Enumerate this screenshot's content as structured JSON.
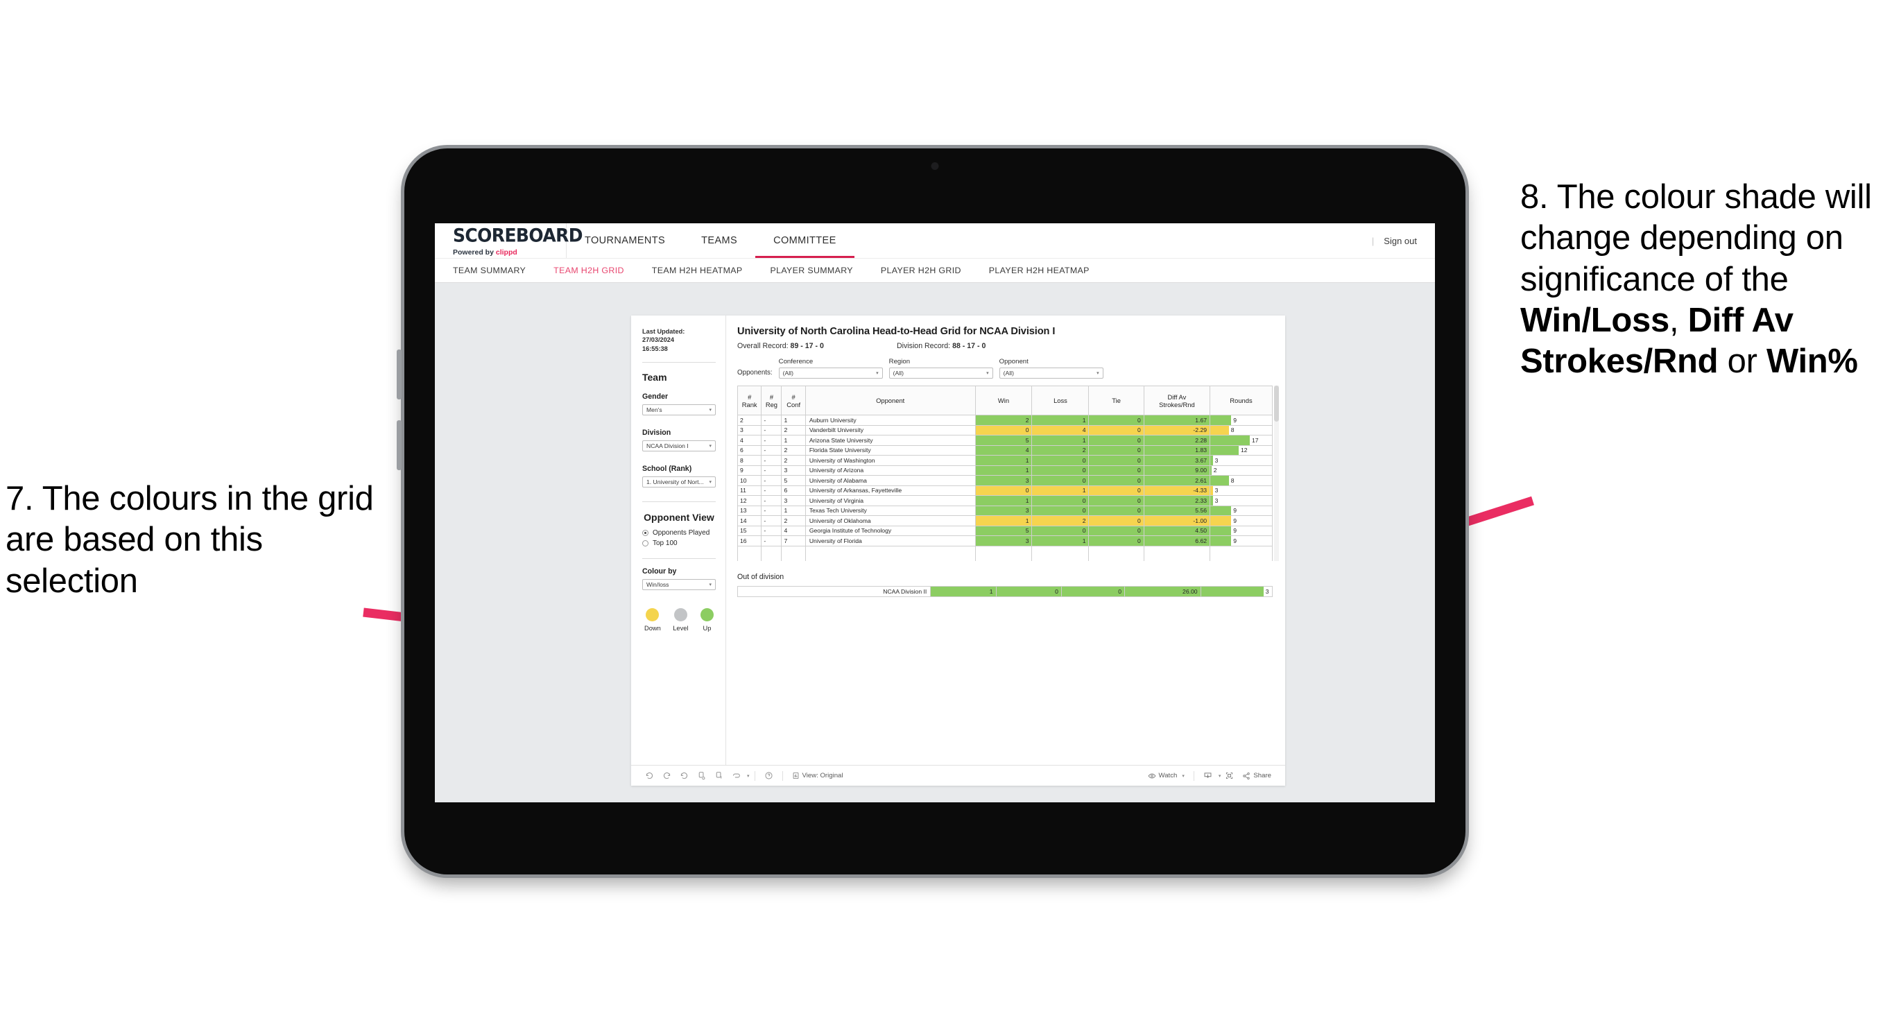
{
  "annotations": {
    "left": {
      "id": "7.",
      "text": "7. The colours in the grid are based on this selection"
    },
    "right": {
      "pre": "8. The colour shade will change depending on significance of the ",
      "b1": "Win/Loss",
      "mid1": ", ",
      "b2": "Diff Av Strokes/Rnd",
      "mid2": " or ",
      "b3": "Win%"
    },
    "arrow_color": "#ea2d62"
  },
  "app": {
    "brand": {
      "logo": "SCOREBOARD",
      "powered_prefix": "Powered by ",
      "powered_brand": "clippd"
    },
    "top_nav": [
      {
        "label": "TOURNAMENTS",
        "active": false
      },
      {
        "label": "TEAMS",
        "active": false
      },
      {
        "label": "COMMITTEE",
        "active": true
      }
    ],
    "top_right": {
      "separator": "|",
      "sign_out": "Sign out"
    },
    "sub_nav": [
      {
        "label": "TEAM SUMMARY",
        "active": false
      },
      {
        "label": "TEAM H2H GRID",
        "active": true
      },
      {
        "label": "TEAM H2H HEATMAP",
        "active": false
      },
      {
        "label": "PLAYER SUMMARY",
        "active": false
      },
      {
        "label": "PLAYER H2H GRID",
        "active": false
      },
      {
        "label": "PLAYER H2H HEATMAP",
        "active": false
      }
    ],
    "accent_color": "#d6204f"
  },
  "sidebar": {
    "last_updated_label": "Last Updated: 27/03/2024",
    "last_updated_time": "16:55:38",
    "team_heading": "Team",
    "gender": {
      "label": "Gender",
      "value": "Men's"
    },
    "division": {
      "label": "Division",
      "value": "NCAA Division I"
    },
    "school": {
      "label": "School (Rank)",
      "value": "1. University of Nort..."
    },
    "opponent_view": {
      "heading": "Opponent View",
      "options": [
        {
          "label": "Opponents Played",
          "selected": true
        },
        {
          "label": "Top 100",
          "selected": false
        }
      ]
    },
    "colour_by": {
      "label": "Colour by",
      "value": "Win/loss"
    },
    "legend": [
      {
        "label": "Down",
        "color": "#f4d44d"
      },
      {
        "label": "Level",
        "color": "#c2c4c6"
      },
      {
        "label": "Up",
        "color": "#8ccd62"
      }
    ]
  },
  "viz": {
    "title": "University of North Carolina Head-to-Head Grid for NCAA Division I",
    "overall_record_label": "Overall Record: ",
    "overall_record_value": "89 - 17 - 0",
    "division_record_label": "Division Record: ",
    "division_record_value": "88 - 17 - 0",
    "opponents_label": "Opponents:",
    "filters": [
      {
        "label": "Conference",
        "value": "(All)"
      },
      {
        "label": "Region",
        "value": "(All)"
      },
      {
        "label": "Opponent",
        "value": "(All)"
      }
    ],
    "out_of_division_heading": "Out of division",
    "out_of_division_row": {
      "name": "NCAA Division II",
      "win": "1",
      "loss": "0",
      "tie": "0",
      "diff": "26.00",
      "rounds": "3",
      "fill": "#8ccd62",
      "rounds_pct": 88
    }
  },
  "chart_data": {
    "type": "table",
    "title": "University of North Carolina Head-to-Head Grid for NCAA Division I",
    "columns": [
      "# Rank",
      "# Reg",
      "# Conf",
      "Opponent",
      "Win",
      "Loss",
      "Tie",
      "Diff Av Strokes/Rnd",
      "Rounds"
    ],
    "colour_by": "Win/loss",
    "colors": {
      "up": "#8ccd62",
      "down": "#f7d濃",
      "down_fix": "#f6d44f",
      "level": "#c2c4c6"
    },
    "rows": [
      {
        "rank": "2",
        "reg": "-",
        "conf": "1",
        "opponent": "Auburn University",
        "win": "2",
        "loss": "1",
        "tie": "0",
        "diff": "1.67",
        "rounds": "9",
        "fill": "up",
        "rounds_pct": 34
      },
      {
        "rank": "3",
        "reg": "-",
        "conf": "2",
        "opponent": "Vanderbilt University",
        "win": "0",
        "loss": "4",
        "tie": "0",
        "diff": "-2.29",
        "rounds": "8",
        "fill": "down",
        "rounds_pct": 30
      },
      {
        "rank": "4",
        "reg": "-",
        "conf": "1",
        "opponent": "Arizona State University",
        "win": "5",
        "loss": "1",
        "tie": "0",
        "diff": "2.28",
        "rounds": "17",
        "fill": "up",
        "rounds_pct": 64
      },
      {
        "rank": "6",
        "reg": "-",
        "conf": "2",
        "opponent": "Florida State University",
        "win": "4",
        "loss": "2",
        "tie": "0",
        "diff": "1.83",
        "rounds": "12",
        "fill": "up",
        "rounds_pct": 46
      },
      {
        "rank": "8",
        "reg": "-",
        "conf": "2",
        "opponent": "University of Washington",
        "win": "1",
        "loss": "0",
        "tie": "0",
        "diff": "3.67",
        "rounds": "3",
        "fill": "up",
        "rounds_pct": 4
      },
      {
        "rank": "9",
        "reg": "-",
        "conf": "3",
        "opponent": "University of Arizona",
        "win": "1",
        "loss": "0",
        "tie": "0",
        "diff": "9.00",
        "rounds": "2",
        "fill": "up",
        "rounds_pct": 2
      },
      {
        "rank": "10",
        "reg": "-",
        "conf": "5",
        "opponent": "University of Alabama",
        "win": "3",
        "loss": "0",
        "tie": "0",
        "diff": "2.61",
        "rounds": "8",
        "fill": "up",
        "rounds_pct": 30
      },
      {
        "rank": "11",
        "reg": "-",
        "conf": "6",
        "opponent": "University of Arkansas, Fayetteville",
        "win": "0",
        "loss": "1",
        "tie": "0",
        "diff": "-4.33",
        "rounds": "3",
        "fill": "down",
        "rounds_pct": 4
      },
      {
        "rank": "12",
        "reg": "-",
        "conf": "3",
        "opponent": "University of Virginia",
        "win": "1",
        "loss": "0",
        "tie": "0",
        "diff": "2.33",
        "rounds": "3",
        "fill": "up",
        "rounds_pct": 4
      },
      {
        "rank": "13",
        "reg": "-",
        "conf": "1",
        "opponent": "Texas Tech University",
        "win": "3",
        "loss": "0",
        "tie": "0",
        "diff": "5.56",
        "rounds": "9",
        "fill": "up",
        "rounds_pct": 34
      },
      {
        "rank": "14",
        "reg": "-",
        "conf": "2",
        "opponent": "University of Oklahoma",
        "win": "1",
        "loss": "2",
        "tie": "0",
        "diff": "-1.00",
        "rounds": "9",
        "fill": "down",
        "rounds_pct": 34
      },
      {
        "rank": "15",
        "reg": "-",
        "conf": "4",
        "opponent": "Georgia Institute of Technology",
        "win": "5",
        "loss": "0",
        "tie": "0",
        "diff": "4.50",
        "rounds": "9",
        "fill": "up",
        "rounds_pct": 34
      },
      {
        "rank": "16",
        "reg": "-",
        "conf": "7",
        "opponent": "University of Florida",
        "win": "3",
        "loss": "1",
        "tie": "0",
        "diff": "6.62",
        "rounds": "9",
        "fill": "up",
        "rounds_pct": 34
      }
    ]
  },
  "toolbar": {
    "view_label": "View: Original",
    "watch_label": "Watch",
    "share_label": "Share"
  }
}
